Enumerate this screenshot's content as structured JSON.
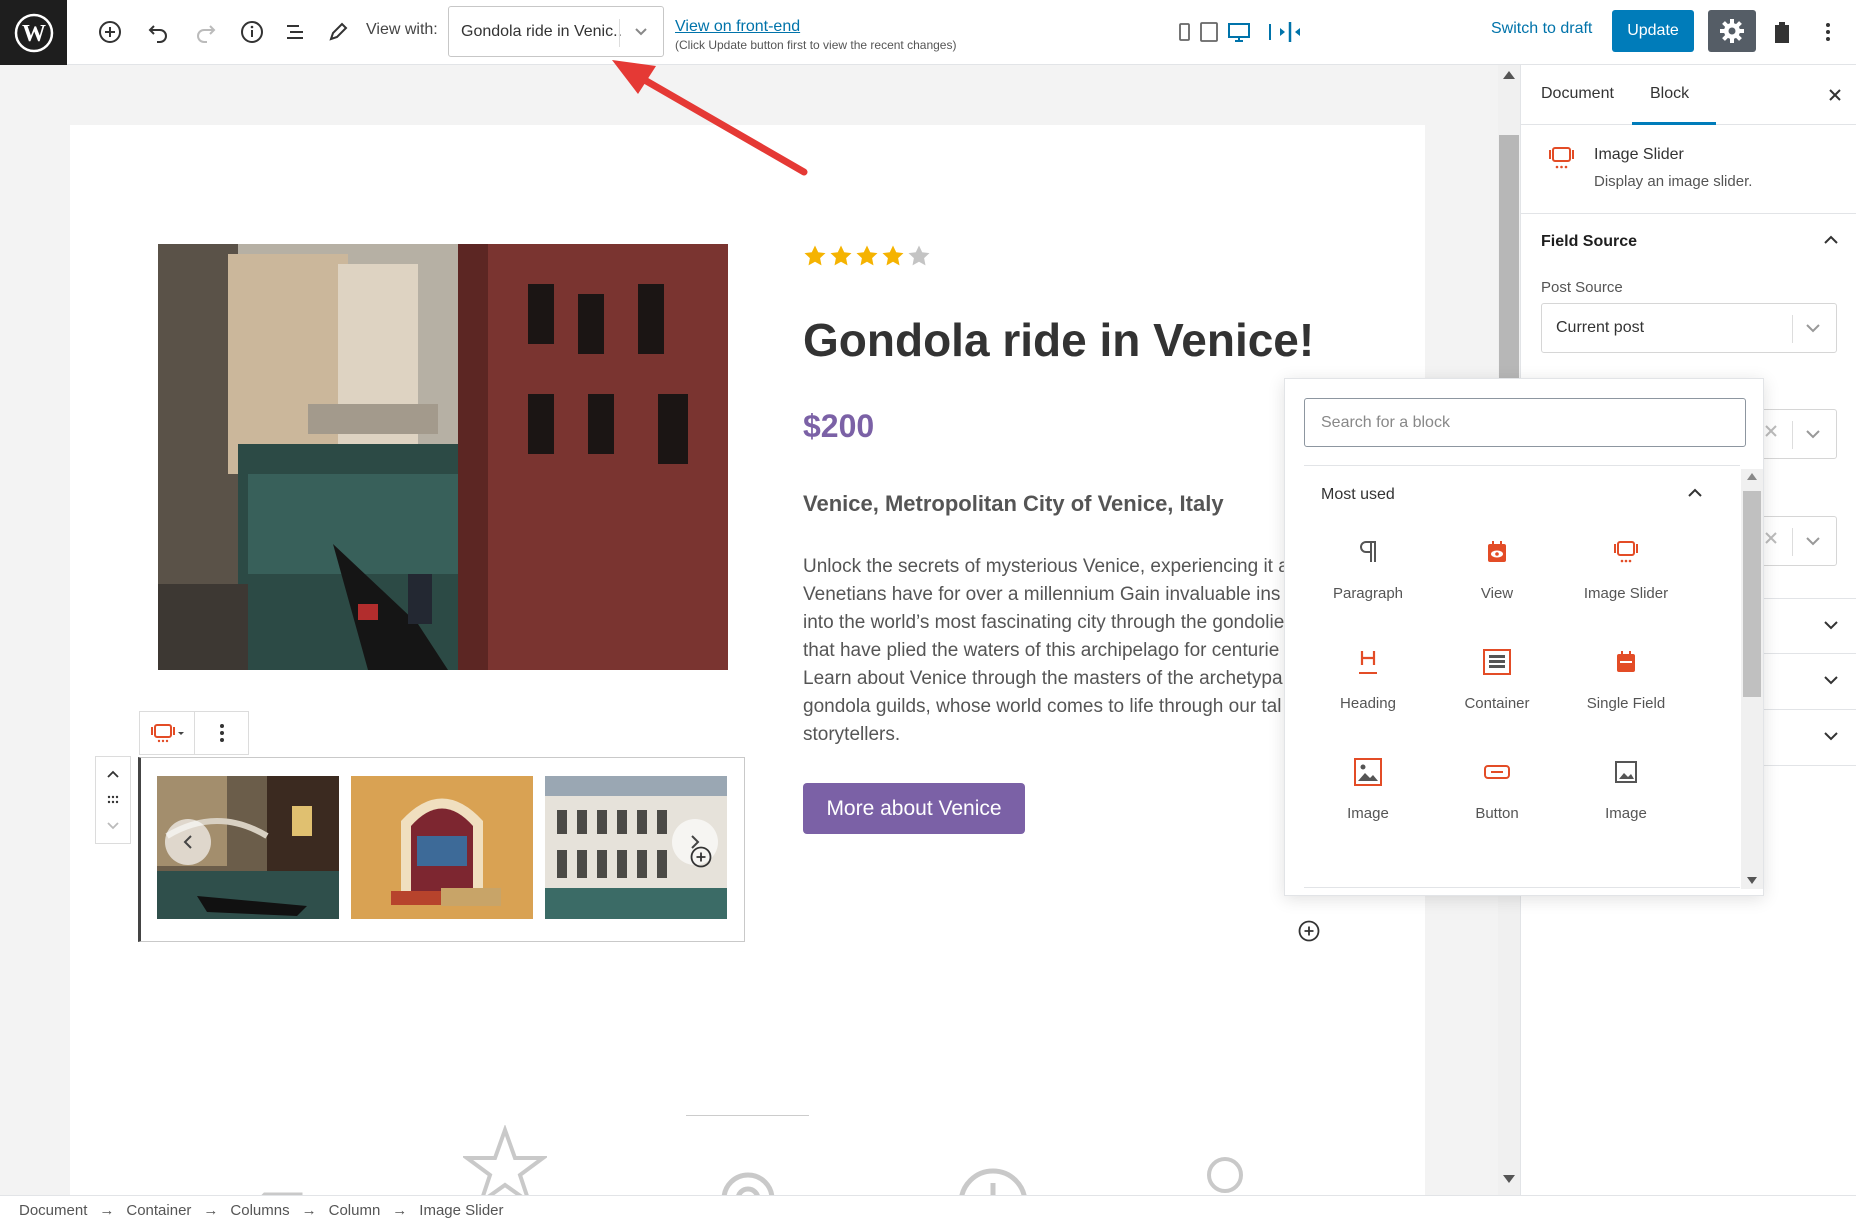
{
  "toolbar": {
    "view_with_label": "View with:",
    "view_with_value": "Gondola ride in Venic...",
    "front_link": "View on front-end",
    "front_note": "(Click Update button first to view the recent changes)",
    "switch_draft": "Switch to draft",
    "update": "Update"
  },
  "content": {
    "rating": 4,
    "rating_max": 5,
    "title": "Gondola ride in Venice!",
    "price": "$200",
    "location": "Venice, Metropolitan City of Venice, Italy",
    "description": [
      "Unlock the secrets of mysterious Venice, experiencing it a",
      "Venetians have for over a millennium Gain invaluable ins",
      "into the world’s most fascinating city through the gondolie",
      "that have plied the waters of this archipelago for centurie",
      "Learn about Venice through the masters of the archetypa",
      "gondola guilds, whose world comes to life through our tal",
      "storytellers."
    ],
    "button": "More about Venice"
  },
  "sidebar": {
    "tab_document": "Document",
    "tab_block": "Block",
    "block_title": "Image Slider",
    "block_desc": "Display an image slider.",
    "field_source": "Field Source",
    "post_source_label": "Post Source",
    "post_source_value": "Current post"
  },
  "inserter": {
    "search_placeholder": "Search for a block",
    "category": "Most used",
    "items": [
      "Paragraph",
      "View",
      "Image Slider",
      "Heading",
      "Container",
      "Single Field",
      "Image",
      "Button",
      "Image"
    ]
  },
  "breadcrumb": [
    "Document",
    "Container",
    "Columns",
    "Column",
    "Image Slider"
  ],
  "colors": {
    "accent": "#007cba",
    "brand_purple": "#7b61a6",
    "star": "#f5b301",
    "block_icon": "#e34c26",
    "annotation_arrow": "#e53935"
  }
}
